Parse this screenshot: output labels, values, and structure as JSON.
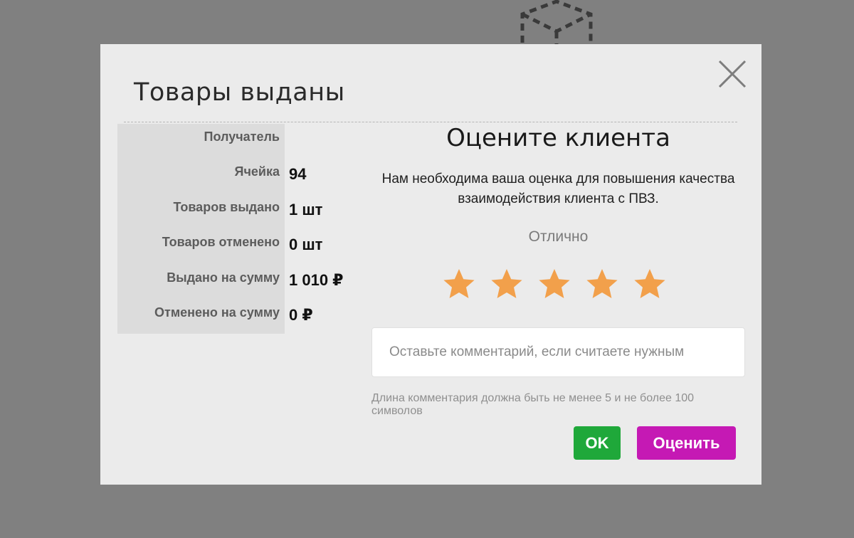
{
  "modal": {
    "title": "Товары выданы",
    "close_icon": "close-icon"
  },
  "details": [
    {
      "label": "Получатель",
      "value": ""
    },
    {
      "label": "Ячейка",
      "value": "94"
    },
    {
      "label": "Товаров выдано",
      "value": "1 шт"
    },
    {
      "label": "Товаров отменено",
      "value": "0 шт"
    },
    {
      "label": "Выдано на сумму",
      "value": "1 010 ₽"
    },
    {
      "label": "Отменено на сумму",
      "value": "0 ₽"
    }
  ],
  "rating": {
    "title": "Оцените клиента",
    "description": "Нам необходима ваша оценка для повышения качества взаимодействия клиента с ПВЗ.",
    "selected_label": "Отлично",
    "stars_total": 5,
    "stars_selected": 5,
    "star_color": "#f2a04b",
    "comment_placeholder": "Оставьте комментарий, если считаете нужным",
    "comment_value": "",
    "hint": "Длина комментария должна быть не менее 5 и не более 100 символов"
  },
  "buttons": {
    "ok_label": "OK",
    "rate_label": "Оценить",
    "ok_color": "#1fa83a",
    "rate_color": "#c519b4"
  }
}
